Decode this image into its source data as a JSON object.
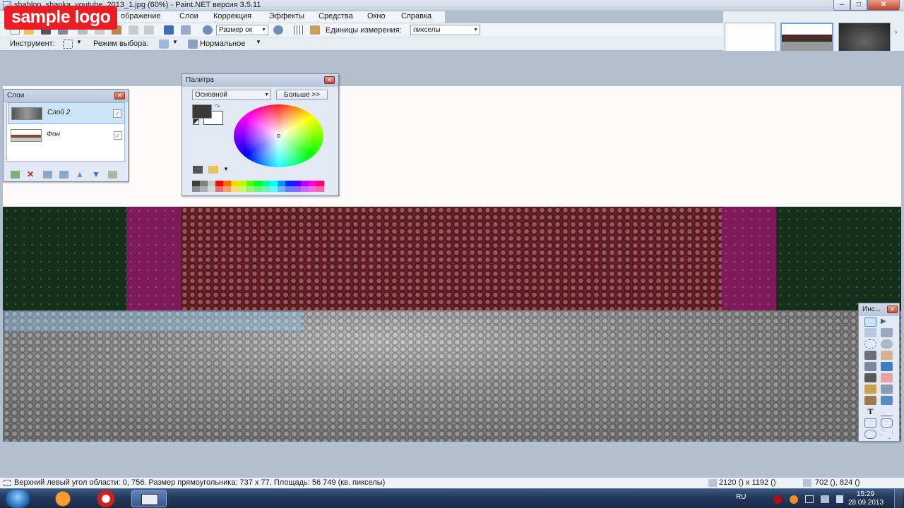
{
  "window": {
    "title": "shablon_shapka_youtube_2013_1.jpg (60%) - Paint.NET версия 3.5.11",
    "min": "–",
    "max": "□",
    "close": "✕"
  },
  "logo": "sample logo",
  "menu": [
    "ображение",
    "Слои",
    "Коррекция",
    "Эффекты",
    "Средства",
    "Окно",
    "Справка"
  ],
  "toolbar": {
    "zoom_value": "Размер ок",
    "units_label": "Единицы измерения:",
    "units_value": "пикселы",
    "tool_label": "Инструмент:",
    "selection_mode_label": "Режим выбора:",
    "blend_mode": "Нормальное"
  },
  "layers_panel": {
    "title": "Слои",
    "layers": [
      {
        "name": "Слой 2",
        "visible": true
      },
      {
        "name": "Фон",
        "visible": true
      }
    ]
  },
  "palette_panel": {
    "title": "Палитра",
    "mode": "Основной",
    "more_button": "Больше >>",
    "primary_color": "#3a3a3a",
    "secondary_color": "#ffffff",
    "swatches": [
      "#404040",
      "#808080",
      "#c8c8c8",
      "#ff0000",
      "#ff6a00",
      "#ffd800",
      "#b6ff00",
      "#4cff00",
      "#00ff21",
      "#00ff90",
      "#00ffff",
      "#0094ff",
      "#0026ff",
      "#4800ff",
      "#b200ff",
      "#ff00dc",
      "#ff006e"
    ]
  },
  "tools_panel": {
    "title": "Инс..."
  },
  "status": {
    "selection_info": "Верхний левый угол области: 0, 756. Размер прямоугольника: 737 x 77. Площадь: 56 749 (кв. пикселы)",
    "image_size": "2120 () x 1192 ()",
    "cursor_pos": "702 (), 824 ()"
  },
  "taskbar": {
    "lang": "RU",
    "time": "15:29",
    "date": "28.09.2013"
  },
  "colors": {
    "green_band": "#14301a",
    "magenta_band": "#7e1a5a",
    "red_band": "#6e2024",
    "canvas_bg": "#b4bfd0"
  }
}
